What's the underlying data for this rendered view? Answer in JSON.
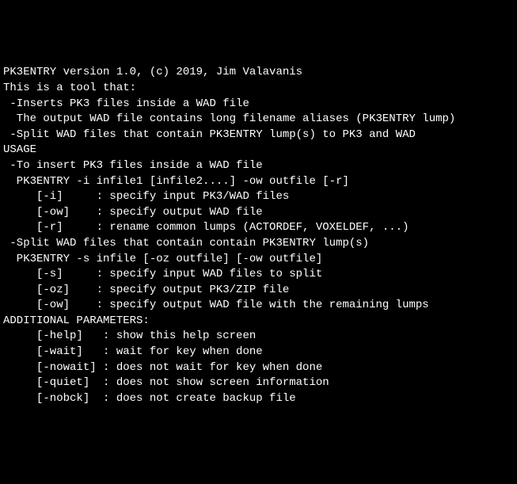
{
  "lines": {
    "l0": "PK3ENTRY version 1.0, (c) 2019, Jim Valavanis",
    "l1": "This is a tool that:",
    "l2": " -Inserts PK3 files inside a WAD file",
    "l3": "  The output WAD file contains long filename aliases (PK3ENTRY lump)",
    "l4": " -Split WAD files that contain PK3ENTRY lump(s) to PK3 and WAD",
    "l5": "",
    "l6": "USAGE",
    "l7": " -To insert PK3 files inside a WAD file",
    "l8": "  PK3ENTRY -i infile1 [infile2....] -ow outfile [-r]",
    "l9": "     [-i]     : specify input PK3/WAD files",
    "l10": "     [-ow]    : specify output WAD file",
    "l11": "     [-r]     : rename common lumps (ACTORDEF, VOXELDEF, ...)",
    "l12": "",
    "l13": " -Split WAD files that contain contain PK3ENTRY lump(s)",
    "l14": "  PK3ENTRY -s infile [-oz outfile] [-ow outfile]",
    "l15": "     [-s]     : specify input WAD files to split",
    "l16": "     [-oz]    : specify output PK3/ZIP file",
    "l17": "     [-ow]    : specify output WAD file with the remaining lumps",
    "l18": "",
    "l19": "ADDITIONAL PARAMETERS:",
    "l20": "     [-help]   : show this help screen",
    "l21": "     [-wait]   : wait for key when done",
    "l22": "     [-nowait] : does not wait for key when done",
    "l23": "     [-quiet]  : does not show screen information",
    "l24": "     [-nobck]  : does not create backup file"
  }
}
